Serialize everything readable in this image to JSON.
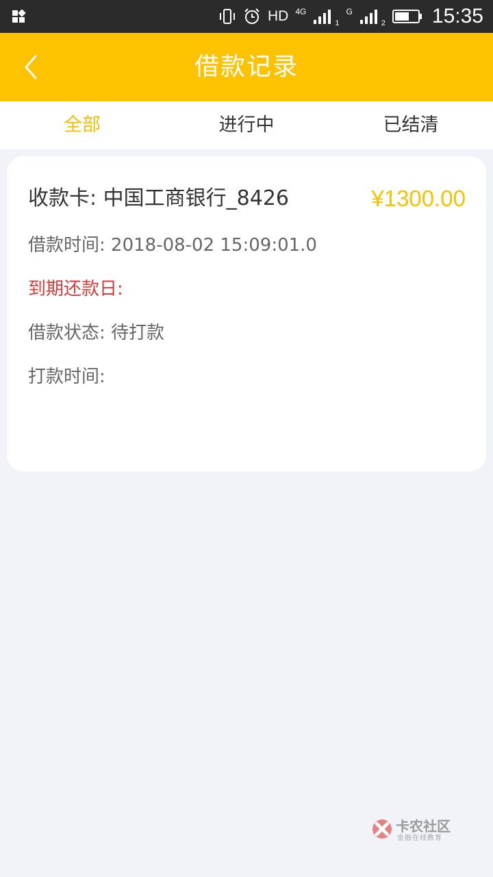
{
  "status_bar": {
    "hd": "HD",
    "network_4g": "4G",
    "network_g": "G",
    "sim1": "1",
    "sim2": "2",
    "time": "15:35",
    "icons": [
      "app-grid-icon",
      "vibrate-icon",
      "alarm-icon",
      "signal-icon",
      "battery-icon"
    ]
  },
  "header": {
    "title": "借款记录",
    "back_icon": "chevron-left-icon"
  },
  "tabs": [
    {
      "label": "全部",
      "active": true
    },
    {
      "label": "进行中",
      "active": false
    },
    {
      "label": "已结清",
      "active": false
    }
  ],
  "record": {
    "receive_card": "收款卡: 中国工商银行_8426",
    "amount": "¥1300.00",
    "loan_time": "借款时间: 2018-08-02 15:09:01.0",
    "due_date": "到期还款日:",
    "loan_status": "借款状态: 待打款",
    "payment_time": "打款时间:"
  },
  "watermark": {
    "title": "卡农社区",
    "subtitle": "金融在线教育"
  },
  "colors": {
    "accent": "#fdc200",
    "amount": "#f5c400",
    "due": "#d23c3c",
    "background": "#f2f3f8"
  }
}
